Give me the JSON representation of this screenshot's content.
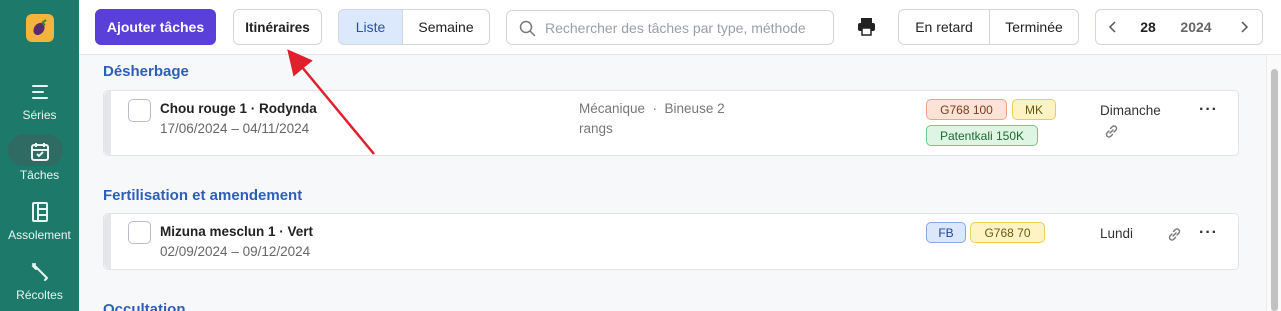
{
  "sidebar": {
    "items": [
      {
        "label": "Séries",
        "icon": "series-icon"
      },
      {
        "label": "Tâches",
        "icon": "calendar-check-icon",
        "active": true
      },
      {
        "label": "Assolement",
        "icon": "assolement-icon"
      },
      {
        "label": "Récoltes",
        "icon": "harvest-icon"
      }
    ]
  },
  "toolbar": {
    "add_label": "Ajouter tâches",
    "itineraires_label": "Itinéraires",
    "view_list": "Liste",
    "view_week": "Semaine",
    "search_placeholder": "Rechercher des tâches par type, méthode",
    "filter_late": "En retard",
    "filter_done": "Terminée",
    "week_number": "28",
    "year": "2024"
  },
  "sections": [
    {
      "title": "Désherbage",
      "tasks": [
        {
          "title": "Chou rouge 1 · Rodynda",
          "dates": "17/06/2024 – 04/11/2024",
          "method_line1": "Mécanique  ·  Bineuse 2",
          "method_line2": "rangs",
          "tags": [
            {
              "label": "G768 100",
              "color": "orange"
            },
            {
              "label": "MK",
              "color": "yellow"
            },
            {
              "label": "Patentkali 150K",
              "color": "green"
            }
          ],
          "day": "Dimanche"
        }
      ]
    },
    {
      "title": "Fertilisation et amendement",
      "tasks": [
        {
          "title": "Mizuna mesclun 1 · Vert",
          "dates": "02/09/2024 – 09/12/2024",
          "tags": [
            {
              "label": "FB",
              "color": "blue"
            },
            {
              "label": "G768 70",
              "color": "yellow"
            }
          ],
          "day": "Lundi"
        }
      ]
    },
    {
      "title": "Occultation"
    }
  ],
  "colors": {
    "sidebar": "#1d7a6a",
    "primary": "#5b3fd9",
    "section_title": "#2e5fb8",
    "annotation_arrow": "#e0202c"
  }
}
